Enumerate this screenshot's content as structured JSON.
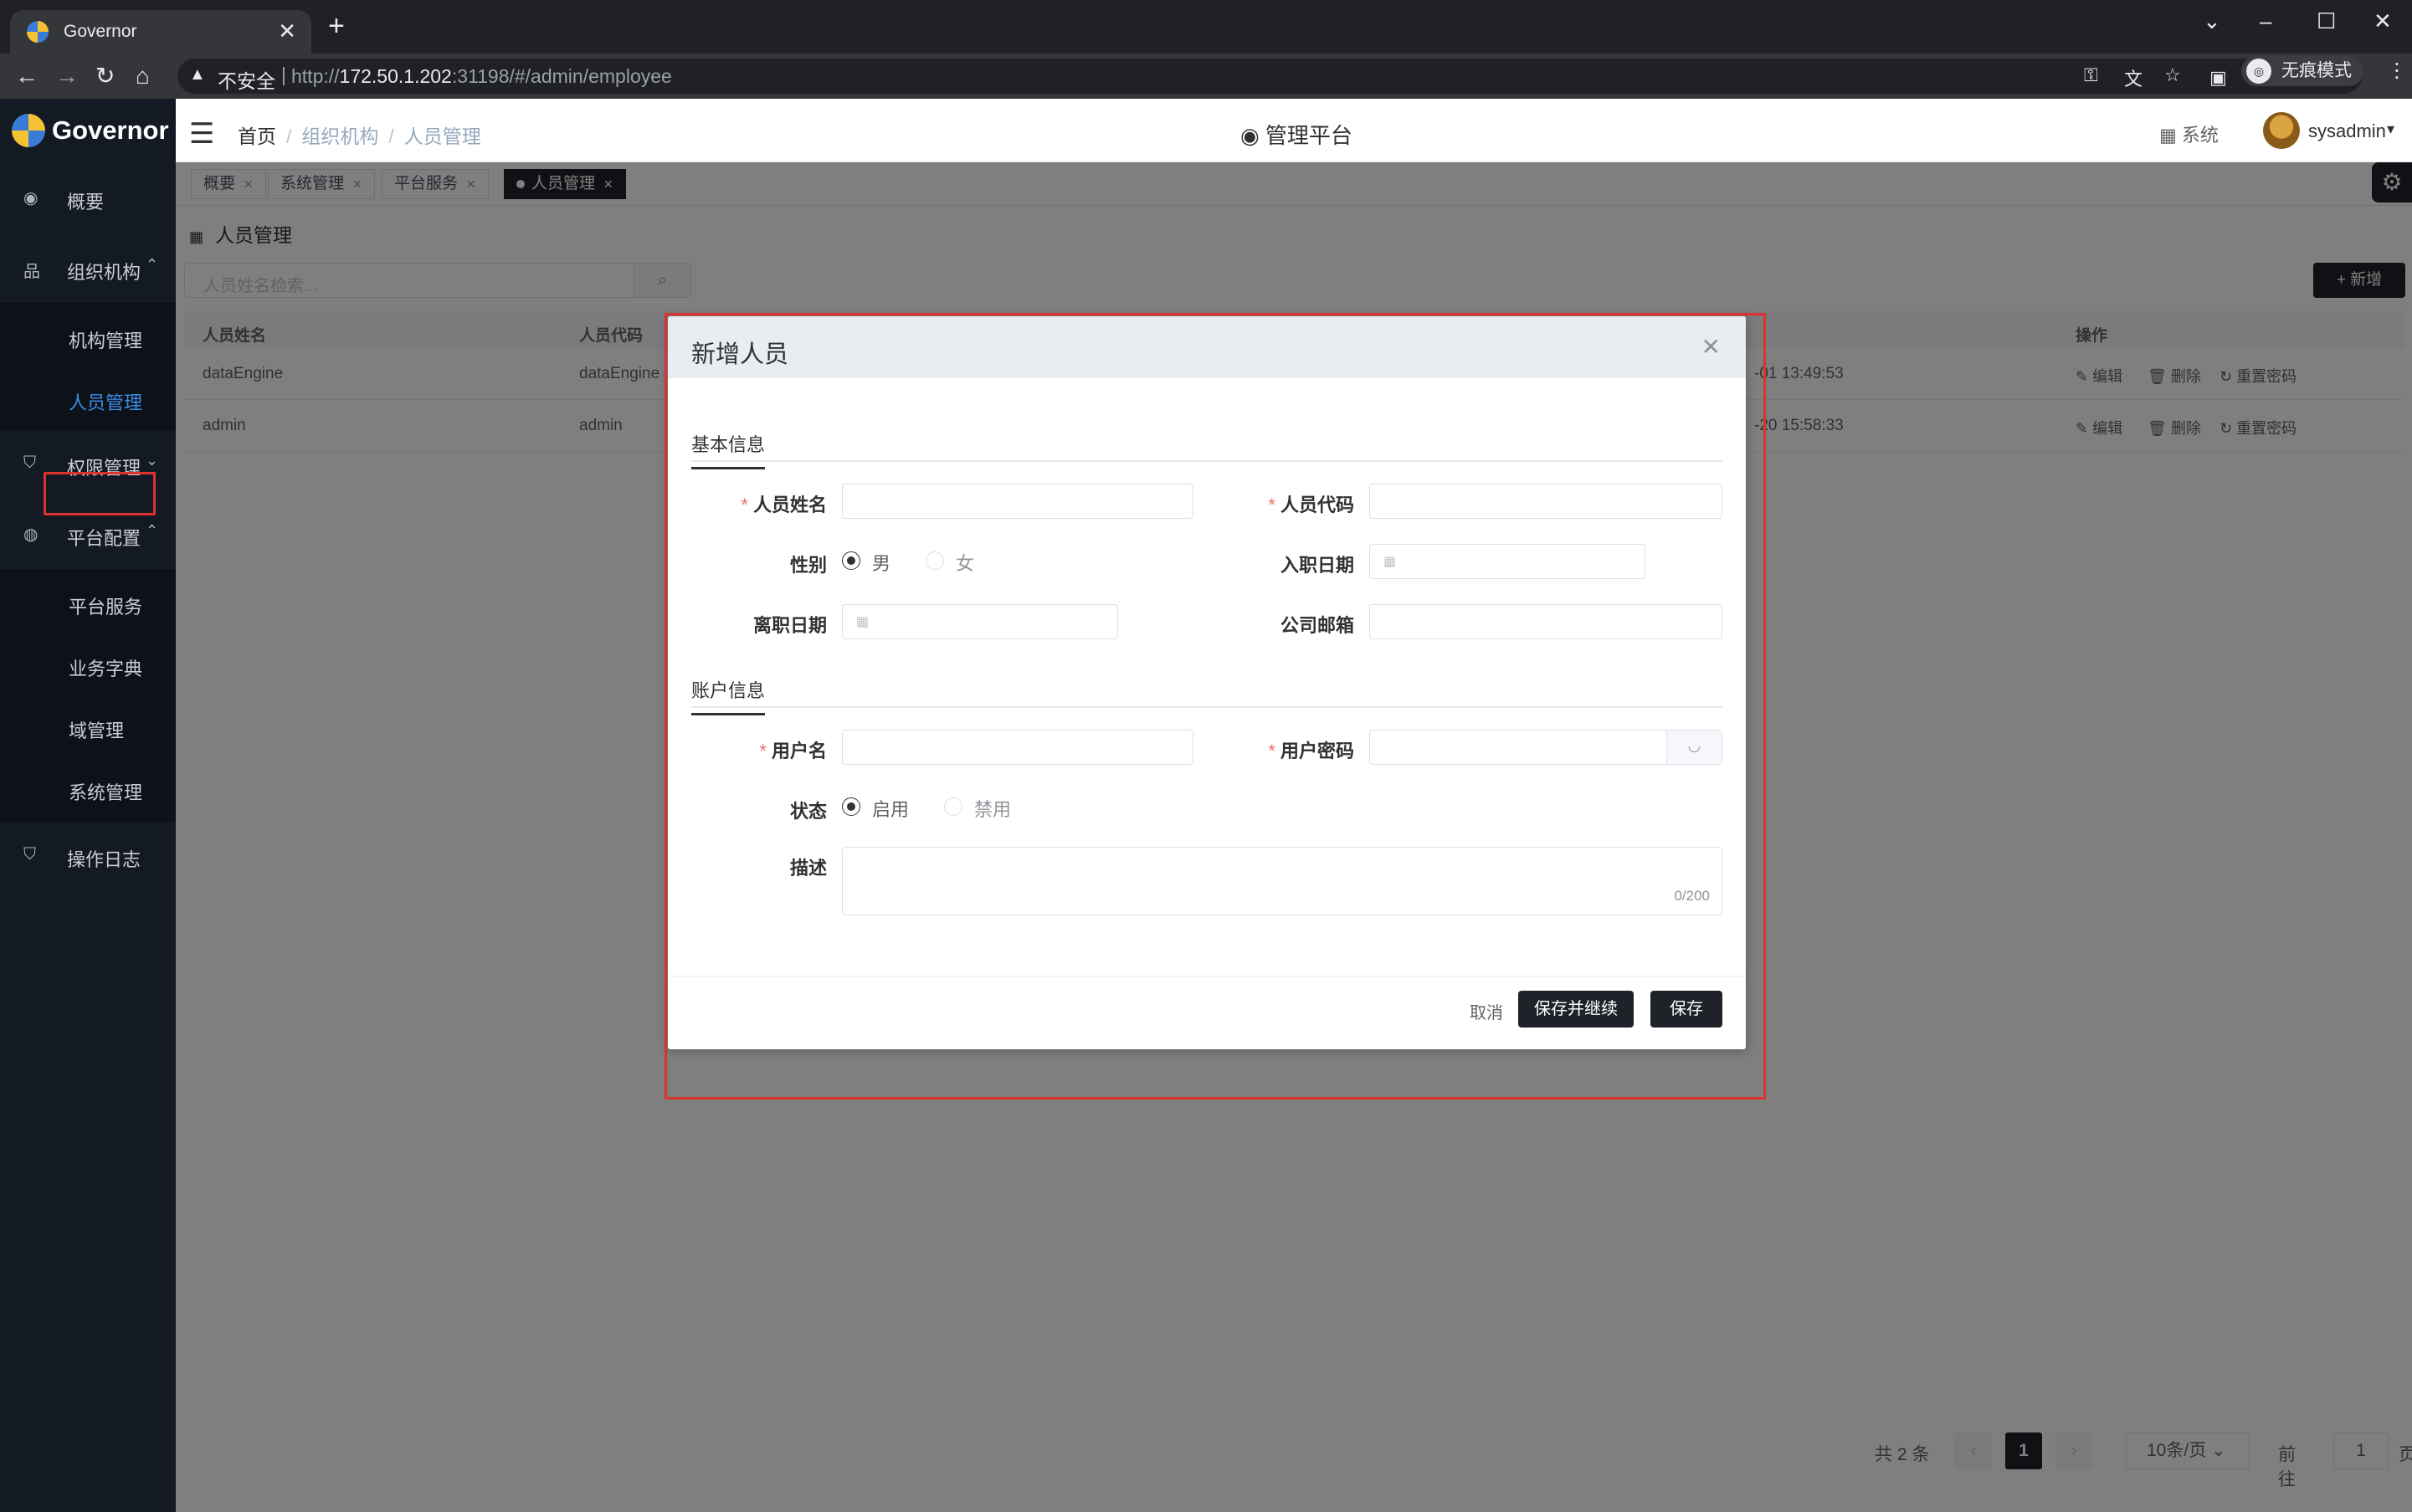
{
  "browser": {
    "tab_title": "Governor",
    "tab_close": "✕",
    "new_tab": "+",
    "insecure_label": "不安全",
    "url_prefix": "http://",
    "url_host": "172.50.1.202",
    "url_rest": ":31198/#/admin/employee",
    "incognito_label": "无痕模式"
  },
  "app": {
    "logo_text": "Governor",
    "breadcrumb": [
      "首页",
      "组织机构",
      "人员管理"
    ],
    "center_title": "管理平台",
    "system_label": "系统",
    "username": "sysadmin"
  },
  "sidebar": {
    "items": [
      {
        "label": "概要",
        "icon": "dashboard-icon"
      },
      {
        "label": "组织机构",
        "icon": "org-icon"
      },
      {
        "label": "权限管理",
        "icon": "shield-icon"
      },
      {
        "label": "平台配置",
        "icon": "globe-icon"
      },
      {
        "label": "操作日志",
        "icon": "log-icon"
      }
    ],
    "org_sub": [
      "机构管理",
      "人员管理"
    ],
    "platform_sub": [
      "平台服务",
      "业务字典",
      "域管理",
      "系统管理"
    ]
  },
  "tags": [
    "概要",
    "系统管理",
    "平台服务",
    "人员管理"
  ],
  "page": {
    "title": "人员管理",
    "search_placeholder": "人员姓名检索...",
    "add_label": "+ 新增"
  },
  "table": {
    "headers": [
      "人员姓名",
      "人员代码",
      "操作"
    ],
    "rows": [
      {
        "name": "dataEngine",
        "code": "dataEngine",
        "time": "-01 13:49:53"
      },
      {
        "name": "admin",
        "code": "admin",
        "time": "-20 15:58:33"
      }
    ],
    "actions": [
      "编辑",
      "删除",
      "重置密码"
    ]
  },
  "pagination": {
    "total": "共 2 条",
    "current": "1",
    "page_size": "10条/页",
    "goto_label": "前往",
    "goto_value": "1",
    "page_suffix": "页"
  },
  "dialog": {
    "title": "新增人员",
    "section_basic": "基本信息",
    "section_account": "账户信息",
    "fields": {
      "name": "人员姓名",
      "code": "人员代码",
      "gender": "性别",
      "join_date": "入职日期",
      "leave_date": "离职日期",
      "email": "公司邮箱",
      "username": "用户名",
      "password": "用户密码",
      "status": "状态",
      "desc": "描述"
    },
    "gender_options": [
      "男",
      "女"
    ],
    "status_options": [
      "启用",
      "禁用"
    ],
    "desc_counter": "0/200",
    "cancel": "取消",
    "save_continue": "保存并继续",
    "save": "保存"
  },
  "colors": {
    "sidebar_bg": "#141a24",
    "active_link": "#3a8ee6",
    "primary_dark": "#1f2329",
    "highlight_red": "#e03131"
  }
}
